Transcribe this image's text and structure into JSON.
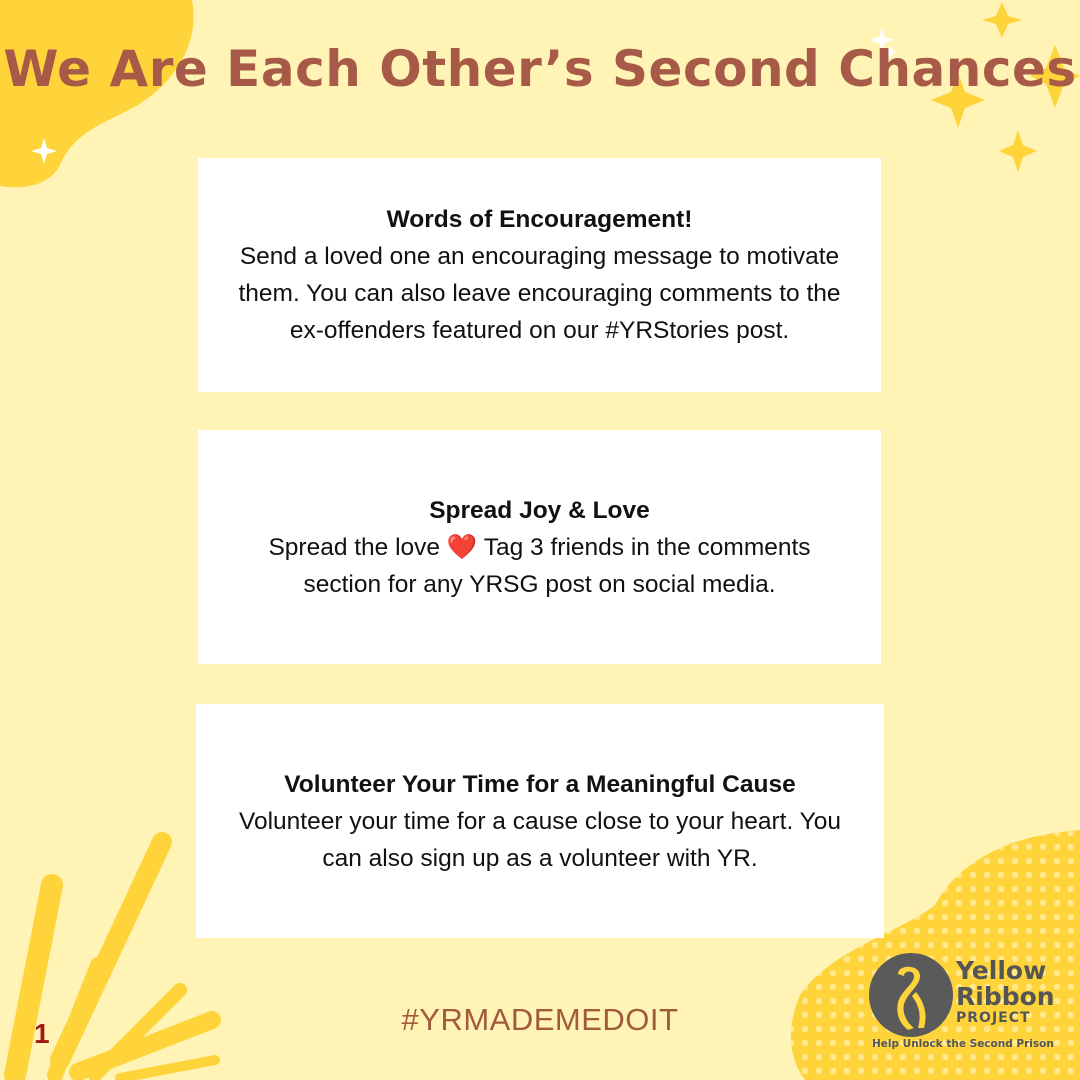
{
  "title": "We Are Each Other’s Second Chances",
  "cards": [
    {
      "heading": "Words of Encouragement!",
      "body": "Send a loved one an encouraging message to motivate them. You can also leave encouraging comments to the ex-offenders featured on our #YRStories post."
    },
    {
      "heading": "Spread Joy & Love",
      "body": "Spread the love ❤️ Tag 3 friends in the comments section for any YRSG post on social media."
    },
    {
      "heading": "Volunteer Your Time for a Meaningful Cause",
      "body": "Volunteer your time for a cause close to your heart. You can also sign up as a volunteer with YR."
    }
  ],
  "hashtag": "#YRMADEMEDOIT",
  "page_number": "1",
  "logo": {
    "line1": "Yellow",
    "line2": "Ribbon",
    "line3": "PROJECT",
    "tagline": "Help Unlock the Second Prison"
  },
  "colors": {
    "background": "#FFF3B5",
    "accent_yellow": "#FFD43B",
    "title": "#A85A48",
    "hashtag": "#A05A3C",
    "page_number": "#A01A12",
    "logo_text": "#555555"
  }
}
